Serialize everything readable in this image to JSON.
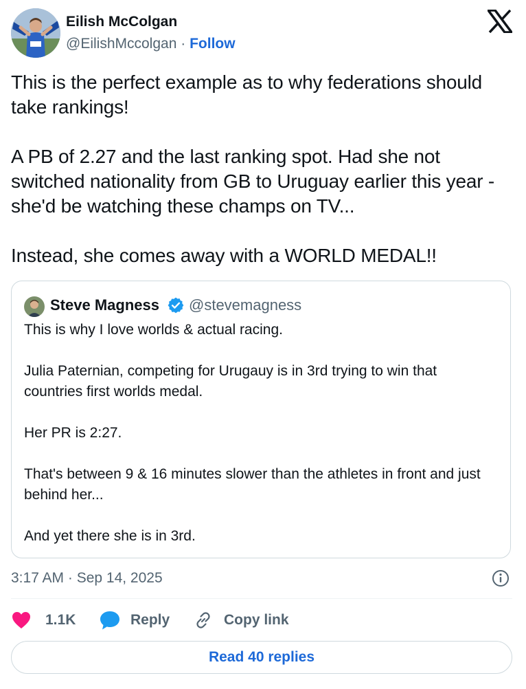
{
  "author": {
    "name": "Eilish McColgan",
    "handle": "@EilishMccolgan",
    "separator": "·",
    "follow_label": "Follow"
  },
  "tweet": {
    "paragraphs": [
      "This is the perfect example as to why federations should take rankings!",
      "A PB of 2.27 and the last ranking spot. Had she not switched nationality from GB to Uruguay earlier this year - she'd be watching these champs on TV...",
      "Instead, she comes away with a WORLD MEDAL!!"
    ]
  },
  "quote": {
    "name": "Steve Magness",
    "handle": "@stevemagness",
    "verified": true,
    "paragraphs": [
      "This is why I love worlds & actual racing.",
      "Julia Paternian, competing for Urugauy is in 3rd trying to win that countries first worlds medal.",
      "Her PR is 2:27.",
      "That's between 9 & 16 minutes slower than the athletes in front and just behind her...",
      "And yet there she is in 3rd."
    ]
  },
  "timestamp": "3:17 AM · Sep 14, 2025",
  "actions": {
    "likes": "1.1K",
    "reply_label": "Reply",
    "copy_label": "Copy link"
  },
  "read_replies_label": "Read 40 replies",
  "colors": {
    "like": "#f91880",
    "link_blue": "#1d69d8",
    "reply_icon": "#1d9bf0",
    "verified": "#1d9bf0",
    "text_primary": "#0f1419",
    "text_secondary": "#536471",
    "border": "#cfd9de"
  },
  "icons": [
    "x-logo-icon",
    "verified-badge-icon",
    "info-icon",
    "heart-icon",
    "reply-bubble-icon",
    "link-icon"
  ]
}
